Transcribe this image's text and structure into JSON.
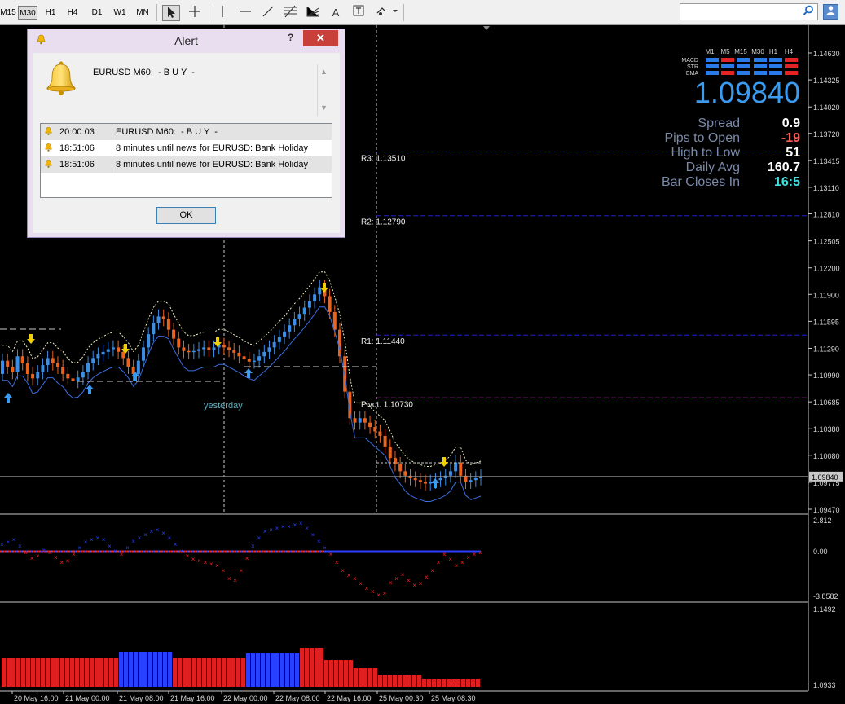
{
  "toolbar": {
    "timeframes": [
      {
        "label": "M15",
        "active": false
      },
      {
        "label": "M30",
        "active": true
      },
      {
        "label": "H1",
        "active": false
      },
      {
        "label": "H4",
        "active": false
      },
      {
        "label": "D1",
        "active": false
      },
      {
        "label": "W1",
        "active": false
      },
      {
        "label": "MN",
        "active": false
      }
    ],
    "tools": [
      "cursor-icon",
      "crosshair-icon",
      "vertical-line-icon",
      "horizontal-line-icon",
      "trendline-icon",
      "fibonacci-icon",
      "fibonacci-fan-icon",
      "text-icon",
      "text-label-icon",
      "shapes-dropdown-icon"
    ],
    "search": {
      "value": "",
      "placeholder": ""
    }
  },
  "alert": {
    "title": "Alert",
    "help": "?",
    "close": "✕",
    "message": "EURUSD M60:  - B U Y  -",
    "rows": [
      {
        "time": "20:00:03",
        "message": "EURUSD M60:  - B U Y  -",
        "selected": true
      },
      {
        "time": "18:51:06",
        "message": "8 minutes until news for EURUSD: Bank Holiday",
        "selected": false
      },
      {
        "time": "18:51:06",
        "message": "8 minutes until news for EURUSD: Bank Holiday",
        "selected": true
      }
    ],
    "ok_label": "OK"
  },
  "dashboard": {
    "timeframes": [
      "M1",
      "M5",
      "M15",
      "M30",
      "H1",
      "H4"
    ],
    "indicators": [
      "MACD",
      "STR",
      "EMA"
    ],
    "signals": [
      [
        "up",
        "down",
        "up",
        "up",
        "up",
        "down"
      ],
      [
        "up",
        "up",
        "up",
        "up",
        "up",
        "down"
      ],
      [
        "up",
        "down",
        "up",
        "up",
        "up",
        "down"
      ]
    ],
    "price": "1.09840",
    "stats": [
      {
        "label": "Spread",
        "value": "0.9",
        "color": "#ffffff"
      },
      {
        "label": "Pips to Open",
        "value": "-19",
        "color": "#ff5a5a"
      },
      {
        "label": "High to Low",
        "value": "51",
        "color": "#ffffff"
      },
      {
        "label": "Daily Avg",
        "value": "160.7",
        "color": "#ffffff"
      },
      {
        "label": "Bar Closes In",
        "value": "16:5",
        "color": "#3fe0e0"
      }
    ]
  },
  "pivots": [
    {
      "label": "R3: 1.13510",
      "value": 1.1351,
      "color": "#2020c8"
    },
    {
      "label": "R2: 1.12790",
      "value": 1.1279,
      "color": "#2020c8"
    },
    {
      "label": "R1: 1.11440",
      "value": 1.1144,
      "color": "#2020c8"
    },
    {
      "label": "Pivot: 1.10730",
      "value": 1.1073,
      "color": "#c828c8"
    }
  ],
  "yesterday_label": "yesterday",
  "chart_data": [
    {
      "type": "candlestick",
      "symbol": "EURUSD",
      "timeframe": "M30",
      "yticks": [
        "1.14630",
        "1.14325",
        "1.14020",
        "1.13720",
        "1.13415",
        "1.13110",
        "1.12810",
        "1.12505",
        "1.12200",
        "1.11900",
        "1.11595",
        "1.11290",
        "1.10990",
        "1.10685",
        "1.10380",
        "1.10080",
        "1.09775",
        "1.09470"
      ],
      "ylim": [
        1.0947,
        1.1463
      ],
      "current_price": "1.09840",
      "xticks": [
        "20 May 16:00",
        "21 May 00:00",
        "21 May 08:00",
        "21 May 16:00",
        "22 May 00:00",
        "22 May 08:00",
        "22 May 16:00",
        "25 May 00:30",
        "25 May 08:30"
      ],
      "close": [
        1.1115,
        1.1108,
        1.1102,
        1.112,
        1.1112,
        1.11,
        1.1095,
        1.1102,
        1.111,
        1.1118,
        1.1112,
        1.1108,
        1.11,
        1.1095,
        1.1092,
        1.1096,
        1.1102,
        1.1112,
        1.1118,
        1.1122,
        1.1125,
        1.1128,
        1.113,
        1.1125,
        1.1118,
        1.1108,
        1.11,
        1.1115,
        1.113,
        1.1145,
        1.1158,
        1.1165,
        1.1162,
        1.115,
        1.114,
        1.113,
        1.1126,
        1.1125,
        1.1126,
        1.1128,
        1.113,
        1.1127,
        1.113,
        1.1133,
        1.113,
        1.1127,
        1.1124,
        1.112,
        1.1117,
        1.1114,
        1.1115,
        1.112,
        1.1125,
        1.113,
        1.1136,
        1.1142,
        1.1148,
        1.1155,
        1.1162,
        1.1168,
        1.1175,
        1.1182,
        1.119,
        1.1198,
        1.1188,
        1.117,
        1.115,
        1.112,
        1.108,
        1.105,
        1.1045,
        1.105,
        1.1045,
        1.104,
        1.1035,
        1.103,
        1.1018,
        1.1005,
        1.0998,
        1.099,
        1.0985,
        1.0982,
        1.098,
        1.0978,
        1.0976,
        1.0978,
        1.098,
        1.0982,
        1.0985,
        1.099,
        1.1,
        1.0985,
        1.0978,
        1.098,
        1.0982,
        1.0984
      ],
      "open": [
        1.11,
        1.1115,
        1.1108,
        1.1102,
        1.112,
        1.1112,
        1.11,
        1.1095,
        1.1102,
        1.111,
        1.1118,
        1.1112,
        1.1108,
        1.11,
        1.1095,
        1.1092,
        1.1096,
        1.1102,
        1.1112,
        1.1118,
        1.1122,
        1.1125,
        1.1128,
        1.113,
        1.1125,
        1.1118,
        1.1108,
        1.11,
        1.1115,
        1.113,
        1.1145,
        1.1158,
        1.1165,
        1.1162,
        1.115,
        1.114,
        1.113,
        1.1126,
        1.1125,
        1.1126,
        1.1128,
        1.113,
        1.1127,
        1.113,
        1.1133,
        1.113,
        1.1127,
        1.1124,
        1.112,
        1.1117,
        1.1114,
        1.1115,
        1.112,
        1.1125,
        1.113,
        1.1136,
        1.1142,
        1.1148,
        1.1155,
        1.1162,
        1.1168,
        1.1175,
        1.1182,
        1.119,
        1.1198,
        1.1188,
        1.117,
        1.115,
        1.112,
        1.108,
        1.105,
        1.1045,
        1.105,
        1.1045,
        1.104,
        1.1035,
        1.103,
        1.1018,
        1.1005,
        1.0998,
        1.099,
        1.0985,
        1.0982,
        1.098,
        1.0978,
        1.0976,
        1.0978,
        1.098,
        1.0982,
        1.0985,
        1.099,
        1.1,
        1.0985,
        1.0978,
        1.098,
        1.0982
      ]
    },
    {
      "type": "scatter",
      "name": "oscillator",
      "yticks": [
        "2.812",
        "0.00",
        "-3.8582"
      ],
      "ylim": [
        -3.8582,
        2.812
      ]
    },
    {
      "type": "bar",
      "name": "histogram",
      "yticks": [
        "1.1492",
        "1.0933"
      ],
      "ylim": [
        1.0933,
        1.1492
      ]
    }
  ]
}
